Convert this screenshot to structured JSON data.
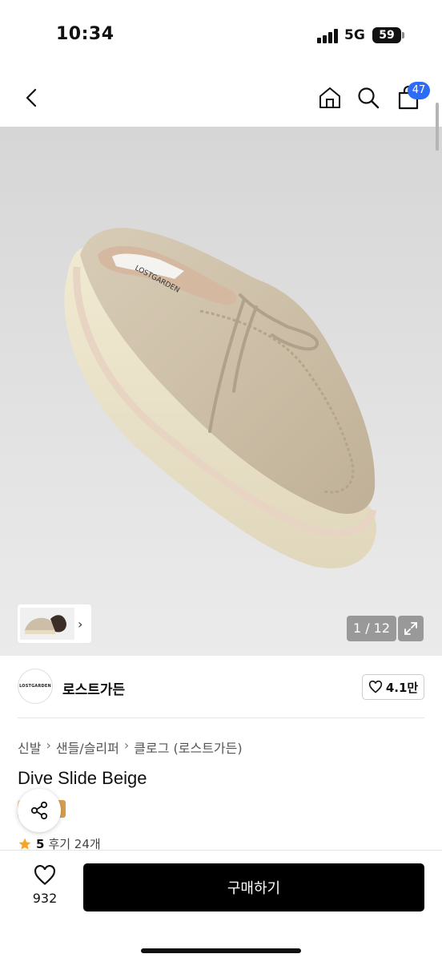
{
  "status_bar": {
    "time": "10:34",
    "network": "5G",
    "battery": "59"
  },
  "nav": {
    "cart_count": "47"
  },
  "gallery": {
    "counter": "1 / 12",
    "shoe_label": "LOSTGARDEN"
  },
  "brand": {
    "logo_text": "LOSTGARDEN",
    "name": "로스트가든",
    "like_count": "4.1만"
  },
  "breadcrumb": [
    "신발",
    "샌들/슬리퍼",
    "클로그 (로스트가든)"
  ],
  "product": {
    "title": "Dive Slide Beige",
    "rating": "5",
    "reviews": "후기 24개"
  },
  "bottom_bar": {
    "wish_count": "932",
    "buy_label": "구매하기"
  },
  "colors": {
    "accent": "#2d6cf6",
    "buy_button": "#000000",
    "star": "#f5a623"
  }
}
